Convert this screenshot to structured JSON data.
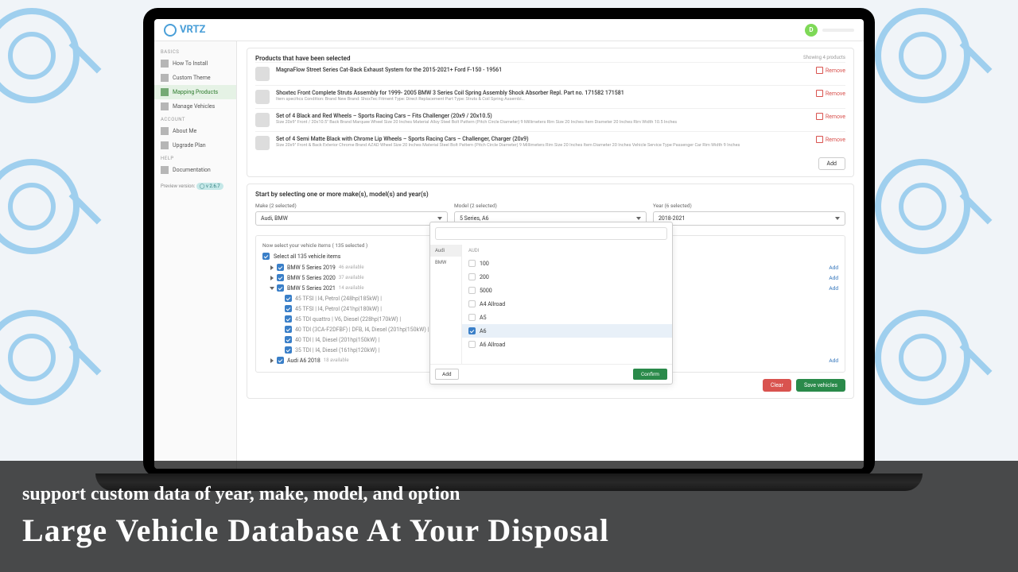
{
  "logo_text": "VRTZ",
  "avatar_letter": "D",
  "sidebar": {
    "basics_label": "BASICS",
    "account_label": "ACCOUNT",
    "help_label": "HELP",
    "items": {
      "install": "How To Install",
      "theme": "Custom Theme",
      "mapping": "Mapping Products",
      "manage": "Manage Vehicles",
      "about": "About Me",
      "upgrade": "Upgrade Plan",
      "docs": "Documentation"
    },
    "preview_label": "Preview version:",
    "preview_pill": "◯ v 2.6.7"
  },
  "products": {
    "title": "Products that have been selected",
    "showing": "Showing 4 products",
    "remove_label": "Remove",
    "add_label": "Add",
    "items": [
      {
        "title": "MagnaFlow Street Series Cat-Back Exhaust System for the 2015-2021+ Ford F-150 - 19561",
        "desc": ""
      },
      {
        "title": "Shoxtec Front Complete Struts Assembly for 1999- 2005 BMW 3 Series Coil Spring Assembly Shock Absorber Repl. Part no. 171582 171581",
        "desc": "Item specifics Condition: Brand New Brand: ShoxTec Fitment Type: Direct Replacement Part Type: Struts & Coil Spring Assembl..."
      },
      {
        "title": "Set of 4 Black and Red Wheels – Sports Racing Cars – Fits Challenger (20x9 / 20x10.5)",
        "desc": "Size 20x9\" Front / 20x10.5\" Back Brand Marquee Wheel Size 20 Inches Material Alloy Steel Bolt Pattern (Pitch Circle Diameter) 9 Millimeters Rim Size 20 Inches Item Diameter 20 Inches Rim Width 10.5 Inches"
      },
      {
        "title": "Set of 4 Semi Matte Black with Chrome Lip Wheels – Sports Racing Cars – Challenger, Charger (20x9)",
        "desc": "Size 20x9\" Front & Back Exterior Chrome Brand AZAD Wheel Size 20 Inches Material Steel Bolt Pattern (Pitch Circle Diameter) 9 Millimeters Rim Size 20 Inches Item Diameter 20 Inches Vehicle Service Type Passenger Car Rim Width 9 Inches"
      }
    ]
  },
  "selectors": {
    "title": "Start by selecting one or more make(s), model(s) and year(s)",
    "make_label": "Make (2 selected)",
    "make_value": "Audi, BMW",
    "model_label": "Model (2 selected)",
    "model_value": "5 Series, A6",
    "year_label": "Year (6 selected)",
    "year_value": "2018-2021"
  },
  "vehicles": {
    "header": "Now select your vehicle items ( 135 selected )",
    "select_all": "Select all 135 vehicle items",
    "add_label": "Add",
    "groups": [
      {
        "name": "BMW 5 Series 2019",
        "avail": "46 available"
      },
      {
        "name": "BMW 5 Series 2020",
        "avail": "37 available"
      },
      {
        "name": "BMW 5 Series 2021",
        "avail": "14 available"
      }
    ],
    "variants": [
      "45 TFSI | I4, Petrol (248hp|185kW) |",
      "45 TFSI | I4, Petrol (241hp|180kW) |",
      "45 TDI quattro | V6, Diesel (228hp|170kW) |",
      "40 TDI (3CA-F2DFBF) | DFB, I4, Diesel (201hp|150kW) |",
      "40 TDI | I4, Diesel (201hp|150kW) |",
      "35 TDI | I4, Diesel (161hp|120kW) |"
    ],
    "audi_group": {
      "name": "Audi A6 2018",
      "avail": "18 available"
    }
  },
  "dropdown": {
    "makes": [
      "Audi",
      "BMW"
    ],
    "head": "AUDI",
    "models": [
      {
        "name": "100",
        "on": false
      },
      {
        "name": "200",
        "on": false
      },
      {
        "name": "5000",
        "on": false
      },
      {
        "name": "A4 Allroad",
        "on": false
      },
      {
        "name": "A5",
        "on": false
      },
      {
        "name": "A6",
        "on": true
      },
      {
        "name": "A6 Allroad",
        "on": false
      }
    ],
    "add_label": "Add",
    "confirm_label": "Confirm"
  },
  "actions": {
    "clear": "Clear",
    "save": "Save vehicles"
  },
  "marketing": {
    "sub": "support custom data of year, make, model, and option",
    "title": "Large Vehicle Database At Your Disposal"
  }
}
